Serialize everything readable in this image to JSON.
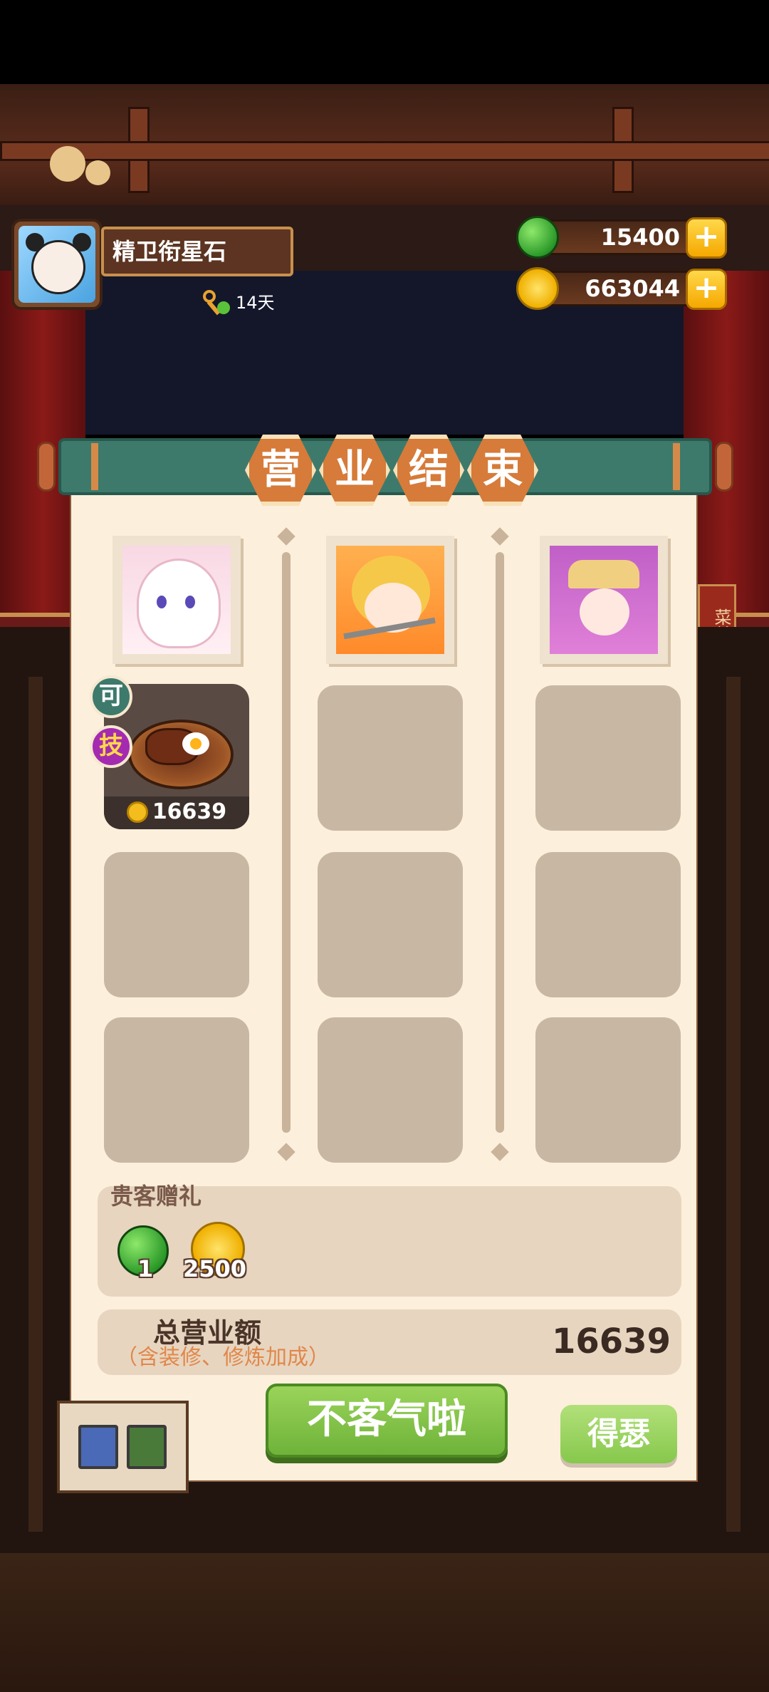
{
  "player": {
    "name": "精卫衔星石",
    "days": "14天"
  },
  "resources": {
    "gems": "15400",
    "coins": "663044",
    "plus": "+"
  },
  "banner": {
    "chars": [
      "营",
      "业",
      "结",
      "束"
    ]
  },
  "dish": {
    "tag_top": "可",
    "tag_bottom": "技",
    "price": "16639"
  },
  "gift": {
    "title": "贵客赠礼",
    "gem_count": "1",
    "coin_count": "2500"
  },
  "revenue": {
    "label": "总营业额",
    "note": "（含装修、修炼加成）",
    "value": "16639"
  },
  "buttons": {
    "main": "不客气啦",
    "secondary": "得瑟"
  },
  "background": {
    "menu_sign": "菜单"
  }
}
